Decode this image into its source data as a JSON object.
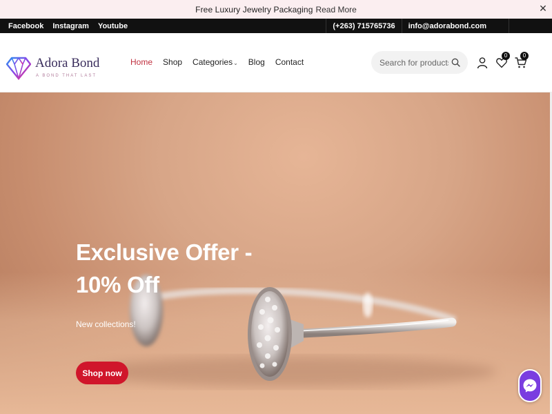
{
  "announcement": {
    "message": "Free Luxury Jewelry Packaging",
    "link": "Read More",
    "close_icon": "close-icon"
  },
  "topbar": {
    "social": [
      "Facebook",
      "Instagram",
      "Youtube"
    ],
    "phone": "(+263) 715765736",
    "email": "info@adorabond.com"
  },
  "brand": {
    "name": "Adora Bond",
    "tagline": "A BOND THAT LAST",
    "logo_icon": "diamond-icon"
  },
  "nav": {
    "home": "Home",
    "shop": "Shop",
    "categories": "Categories",
    "blog": "Blog",
    "contact": "Contact",
    "active": "Home"
  },
  "search": {
    "placeholder": "Search for products",
    "icon": "search-icon"
  },
  "header_icons": {
    "account": "user-icon",
    "wishlist": "heart-icon",
    "wishlist_count": "0",
    "cart": "cart-icon",
    "cart_count": "0"
  },
  "hero": {
    "title_line1": "Exclusive Offer -",
    "title_line2": "10% Off",
    "subtitle": "New collections!",
    "button": "Shop now"
  },
  "chat": {
    "icon": "messenger-icon"
  },
  "colors": {
    "accent": "#d0162b",
    "topbar": "#111111",
    "announcement_bg": "#fbeef0",
    "messenger": "#7a3de0"
  }
}
